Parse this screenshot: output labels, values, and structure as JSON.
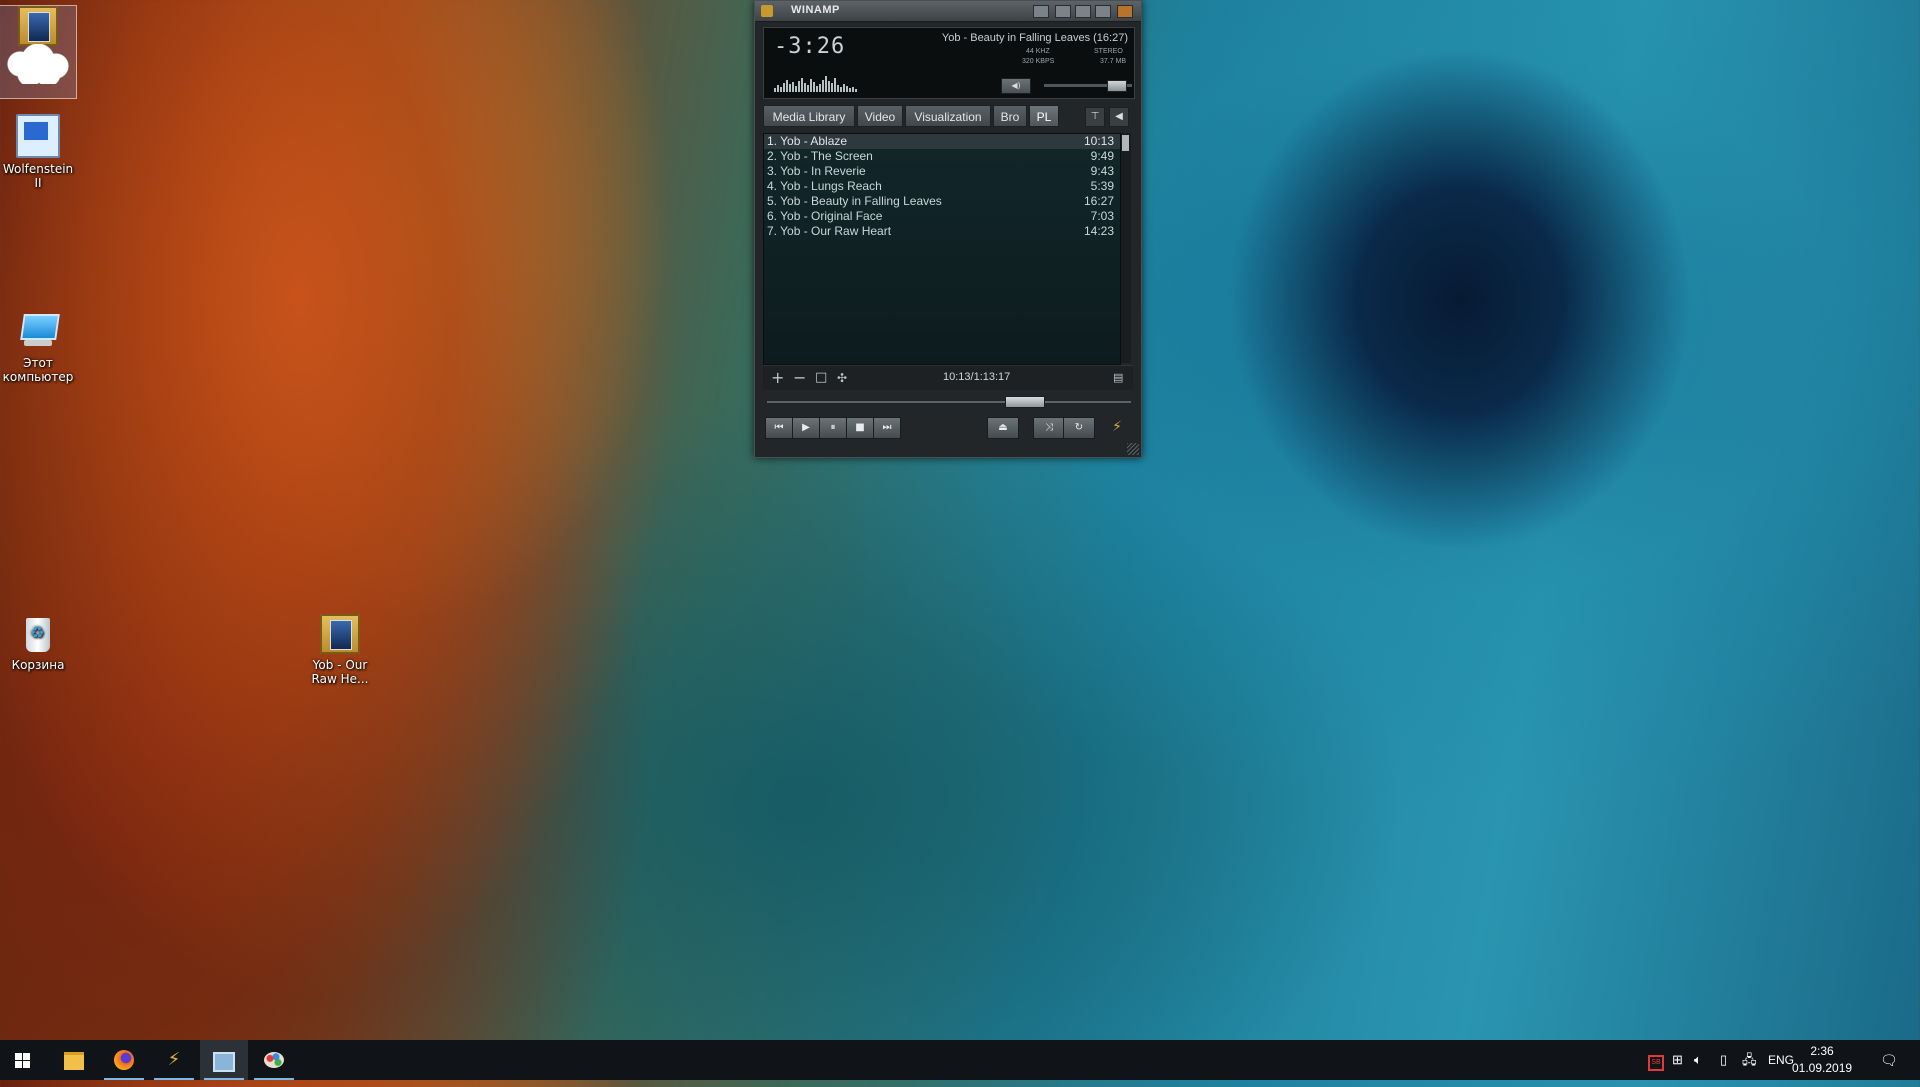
{
  "desktop": {
    "icons": [
      {
        "label": ""
      },
      {
        "label": "Wolfenstein II"
      },
      {
        "label": "Этот компьютер"
      },
      {
        "label": "Корзина"
      },
      {
        "label": "Yob - Our Raw He..."
      }
    ]
  },
  "winamp": {
    "title": "WINAMP",
    "time": "-3:26",
    "now_playing": "Yob - Beauty in Falling Leaves (16:27)",
    "khz": "44 KHZ",
    "kbps": "320 KBPS",
    "stereo": "STEREO",
    "size": "37.7 MB",
    "tabs": [
      {
        "label": "Media Library"
      },
      {
        "label": "Video"
      },
      {
        "label": "Visualization"
      },
      {
        "label": "Bro"
      },
      {
        "label": "PL"
      }
    ],
    "playlist": [
      {
        "title": "1. Yob - Ablaze",
        "duration": "10:13"
      },
      {
        "title": "2. Yob - The Screen",
        "duration": "9:49"
      },
      {
        "title": "3. Yob - In Reverie",
        "duration": "9:43"
      },
      {
        "title": "4. Yob - Lungs Reach",
        "duration": "5:39"
      },
      {
        "title": "5. Yob - Beauty in Falling Leaves",
        "duration": "16:27"
      },
      {
        "title": "6. Yob - Original Face",
        "duration": "7:03"
      },
      {
        "title": "7. Yob - Our Raw Heart",
        "duration": "14:23"
      }
    ],
    "playlist_total": "10:13/1:13:17",
    "seek_fraction": 0.73,
    "volume_fraction": 0.9
  },
  "taskbar": {
    "language": "ENG",
    "time": "2:36",
    "date": "01.09.2019"
  },
  "colors": {
    "accent": "#76b9ed",
    "winamp_bg": "#232628",
    "playlist_bg": "#12272b"
  }
}
